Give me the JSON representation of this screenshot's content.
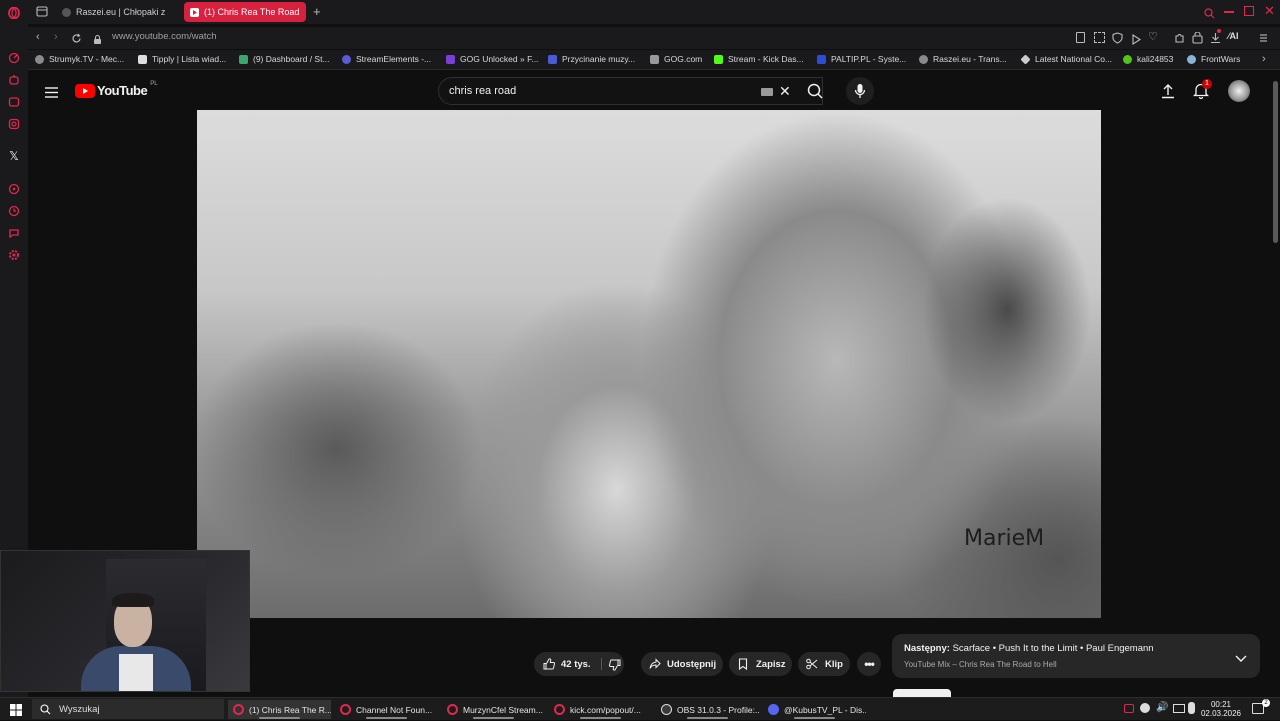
{
  "browser": {
    "tabs": [
      {
        "label": "Raszei.eu | Chłopaki z",
        "active": false
      },
      {
        "label": "(1) Chris Rea The Road",
        "active": true
      }
    ],
    "url": "www.youtube.com/watch",
    "bookmarks": [
      {
        "label": "Strumyk.TV - Mec...",
        "color": "#8a8a8a"
      },
      {
        "label": "Tipply | Lista wiad...",
        "color": "#dddddd"
      },
      {
        "label": "(9) Dashboard / St...",
        "color": "#3aa76d"
      },
      {
        "label": "StreamElements -...",
        "color": "#5b5bd6"
      },
      {
        "label": "GOG Unlocked » F...",
        "color": "#7a3fd6"
      },
      {
        "label": "Przycinanie muzy...",
        "color": "#4b5bd6"
      },
      {
        "label": "GOG.com",
        "color": "#9a9a9a"
      },
      {
        "label": "Stream - Kick Das...",
        "color": "#53fc18"
      },
      {
        "label": "PALTIP.PL - Syste...",
        "color": "#2a4fd6"
      },
      {
        "label": "Raszei.eu - Trans...",
        "color": "#8a8a8a"
      },
      {
        "label": "Latest National Co...",
        "color": "#cccccc"
      },
      {
        "label": "kali24853",
        "color": "#53c518"
      },
      {
        "label": "FrontWars",
        "color": "#8ab4d6"
      }
    ]
  },
  "youtube": {
    "logo_text": "YouTube",
    "region": "PL",
    "search_query": "chris rea road",
    "notification_count": "1",
    "watermark": "MarieM",
    "actions": {
      "likes": "42 tys.",
      "share": "Udostępnij",
      "save": "Zapisz",
      "clip": "Klip"
    },
    "next_up": {
      "prefix": "Następny:",
      "title": "Scarface • Push It to the Limit • Paul Engemann",
      "playlist": "YouTube Mix – Chris Rea The Road to Hell"
    }
  },
  "taskbar": {
    "search_label": "Wyszukaj",
    "items": [
      {
        "label": "(1) Chris Rea The R...",
        "color": "#e2274f"
      },
      {
        "label": "Channel Not Foun...",
        "color": "#e2274f"
      },
      {
        "label": "MurzynCfel Stream...",
        "color": "#e2274f"
      },
      {
        "label": "kick.com/popout/...",
        "color": "#e2274f"
      },
      {
        "label": "OBS 31.0.3 - Profile:...",
        "color": "#3a3a3a"
      },
      {
        "label": "@KubusTV_PL - Dis...",
        "color": "#5865f2"
      }
    ],
    "time": "00:21",
    "date": "02.03.2026"
  }
}
